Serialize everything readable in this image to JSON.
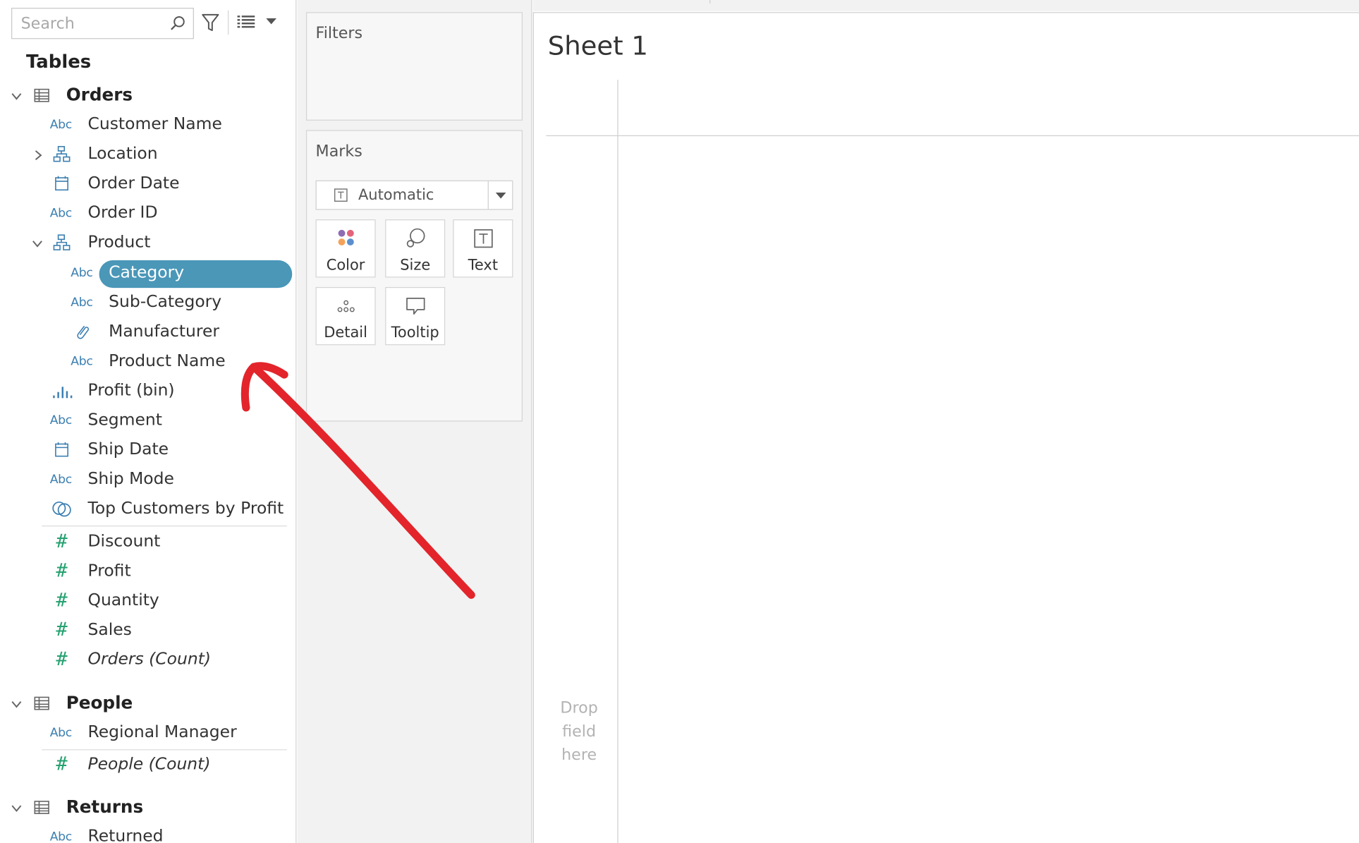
{
  "search": {
    "placeholder": "Search"
  },
  "data_pane": {
    "heading": "Tables",
    "tables": [
      {
        "name": "Orders",
        "fields": [
          {
            "label": "Customer Name",
            "type": "Abc"
          },
          {
            "label": "Location",
            "type": "hierarchy",
            "collapsed": true
          },
          {
            "label": "Order Date",
            "type": "date"
          },
          {
            "label": "Order ID",
            "type": "Abc"
          },
          {
            "label": "Product",
            "type": "hierarchy",
            "collapsed": false
          },
          {
            "label": "Category",
            "type": "Abc",
            "selected": true
          },
          {
            "label": "Sub-Category",
            "type": "Abc"
          },
          {
            "label": "Manufacturer",
            "type": "clip"
          },
          {
            "label": "Product Name",
            "type": "Abc"
          },
          {
            "label": "Profit (bin)",
            "type": "bin"
          },
          {
            "label": "Segment",
            "type": "Abc"
          },
          {
            "label": "Ship Date",
            "type": "date"
          },
          {
            "label": "Ship Mode",
            "type": "Abc"
          },
          {
            "label": "Top Customers by Profit",
            "type": "set"
          },
          {
            "label": "Discount",
            "type": "measure"
          },
          {
            "label": "Profit",
            "type": "measure"
          },
          {
            "label": "Quantity",
            "type": "measure"
          },
          {
            "label": "Sales",
            "type": "measure"
          },
          {
            "label": "Orders (Count)",
            "type": "measure"
          }
        ]
      },
      {
        "name": "People",
        "fields": [
          {
            "label": "Regional Manager",
            "type": "Abc"
          },
          {
            "label": "People (Count)",
            "type": "measure"
          }
        ]
      },
      {
        "name": "Returns",
        "fields": [
          {
            "label": "Returned",
            "type": "Abc"
          }
        ]
      }
    ],
    "abc_glyph": "Abc",
    "hash_glyph": "#"
  },
  "filters": {
    "title": "Filters"
  },
  "marks": {
    "title": "Marks",
    "mark_type": "Automatic",
    "buttons": [
      "Color",
      "Size",
      "Text",
      "Detail",
      "Tooltip"
    ]
  },
  "sheet": {
    "title": "Sheet 1",
    "drop_hint": [
      "Drop",
      "field",
      "here"
    ]
  },
  "colors": {
    "selected": "#4a97b8",
    "dimension": "#3c7fb1",
    "measure": "#25a170",
    "annotation": "#e3242b"
  }
}
